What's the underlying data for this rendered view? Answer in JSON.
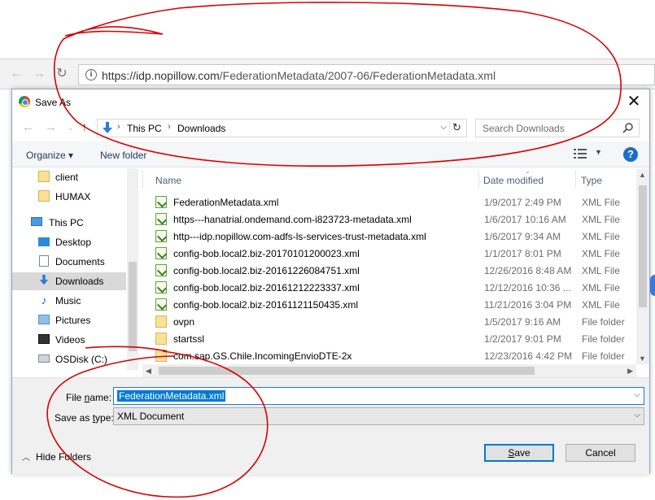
{
  "browser": {
    "url_host": "https://idp.nopillow.com",
    "url_path": "/FederationMetadata/2007-06/FederationMetadata.xml",
    "info_icon": "i"
  },
  "dialog": {
    "title": "Save As",
    "close": "✕",
    "breadcrumb": [
      "This PC",
      "Downloads"
    ],
    "search_placeholder": "Search Downloads",
    "toolbar": {
      "organize": "Organize ▾",
      "new_folder": "New folder",
      "help": "?"
    },
    "nav": [
      {
        "label": "client",
        "icon": "folder-icon"
      },
      {
        "label": "HUMAX",
        "icon": "folder-icon"
      },
      {
        "label": "This PC",
        "icon": "computer-icon"
      },
      {
        "label": "Desktop",
        "icon": "desktop-icon"
      },
      {
        "label": "Documents",
        "icon": "documents-icon"
      },
      {
        "label": "Downloads",
        "icon": "downloads-icon",
        "selected": true
      },
      {
        "label": "Music",
        "icon": "music-icon"
      },
      {
        "label": "Pictures",
        "icon": "pictures-icon"
      },
      {
        "label": "Videos",
        "icon": "videos-icon"
      },
      {
        "label": "OSDisk (C:)",
        "icon": "disk-icon"
      }
    ],
    "columns": {
      "name": "Name",
      "date": "Date modified",
      "type": "Type"
    },
    "files": [
      {
        "name": "FederationMetadata.xml",
        "date": "1/9/2017 2:49 PM",
        "type": "XML File",
        "kind": "xml"
      },
      {
        "name": "https---hanatrial.ondemand.com-i823723-metadata.xml",
        "date": "1/6/2017 10:16 AM",
        "type": "XML File",
        "kind": "xml"
      },
      {
        "name": "http---idp.nopillow.com-adfs-ls-services-trust-metadata.xml",
        "date": "1/6/2017 9:34 AM",
        "type": "XML File",
        "kind": "xml"
      },
      {
        "name": "config-bob.local2.biz-20170101200023.xml",
        "date": "1/1/2017 8:01 PM",
        "type": "XML File",
        "kind": "xml"
      },
      {
        "name": "config-bob.local2.biz-20161226084751.xml",
        "date": "12/26/2016 8:48 AM",
        "type": "XML File",
        "kind": "xml"
      },
      {
        "name": "config-bob.local2.biz-20161212223337.xml",
        "date": "12/12/2016 10:36 ...",
        "type": "XML File",
        "kind": "xml"
      },
      {
        "name": "config-bob.local2.biz-20161121150435.xml",
        "date": "11/21/2016 3:04 PM",
        "type": "XML File",
        "kind": "xml"
      },
      {
        "name": "ovpn",
        "date": "1/5/2017 9:16 AM",
        "type": "File folder",
        "kind": "folder"
      },
      {
        "name": "startssl",
        "date": "1/2/2017 9:01 PM",
        "type": "File folder",
        "kind": "folder"
      },
      {
        "name": "com.sap.GS.Chile.IncomingEnvioDTE-2x",
        "date": "12/23/2016 4:42 PM",
        "type": "File folder",
        "kind": "folder"
      }
    ],
    "file_name_label_pre": "File ",
    "file_name_label_u": "n",
    "file_name_label_post": "ame:",
    "file_name_value": "FederationMetadata.xml",
    "save_type_label_pre": "Save as ",
    "save_type_label_u": "t",
    "save_type_label_post": "ype:",
    "save_type_value": "XML Document",
    "hide_folders": "Hide Folders",
    "save_label_u": "S",
    "save_label_rest": "ave",
    "cancel_label": "Cancel"
  },
  "colors": {
    "accent": "#0078d7",
    "annotation": "#d90000"
  }
}
